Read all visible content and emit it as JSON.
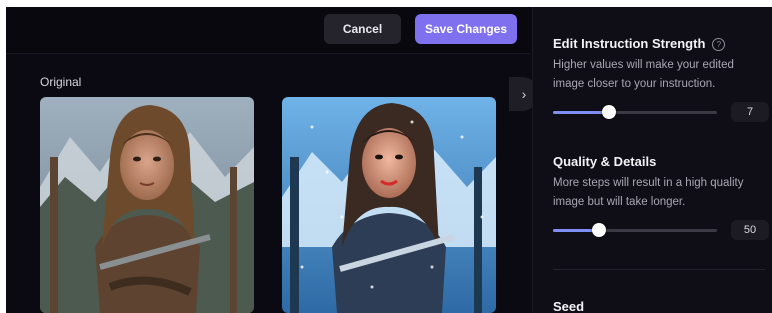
{
  "toolbar": {
    "cancel_label": "Cancel",
    "save_label": "Save Changes"
  },
  "canvas": {
    "original_label": "Original"
  },
  "panel": {
    "toggle_icon": "›",
    "strength": {
      "title": "Edit Instruction Strength",
      "info_icon": "?",
      "description": "Higher values will make your edited image closer to your instruction.",
      "value": "7",
      "slider_fraction": 0.34
    },
    "quality": {
      "title": "Quality & Details",
      "description": "More steps will result in a high quality image but will take longer.",
      "value": "50",
      "slider_fraction": 0.28
    },
    "seed": {
      "title": "Seed"
    }
  },
  "colors": {
    "accent": "#7f70f0",
    "slider_fill": "#7f8ef5",
    "background": "#0b0a12"
  }
}
